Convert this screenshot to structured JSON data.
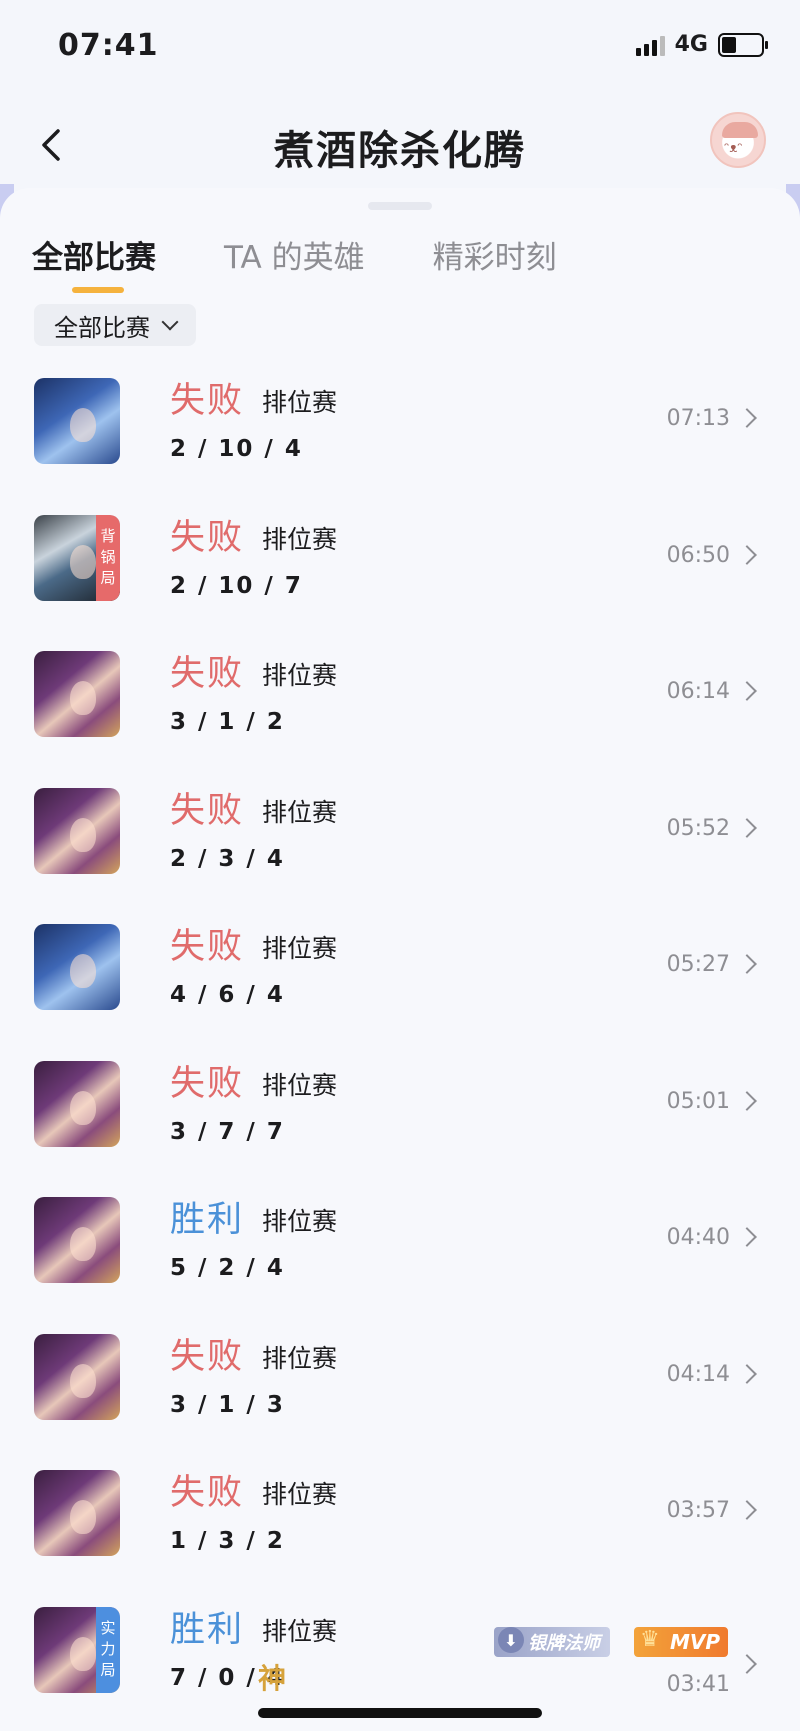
{
  "status_bar": {
    "time": "07:41",
    "network": "4G"
  },
  "header": {
    "title": "煮酒除杀化腾"
  },
  "tabs": [
    {
      "label": "全部比赛",
      "active": true
    },
    {
      "label": "TA 的英雄",
      "active": false
    },
    {
      "label": "精彩时刻",
      "active": false
    }
  ],
  "filter": {
    "label": "全部比赛"
  },
  "matches": [
    {
      "result": "失败",
      "mode": "排位赛",
      "kda": "2 / 10 / 4",
      "time": "07:13",
      "hero": "blue"
    },
    {
      "result": "失败",
      "mode": "排位赛",
      "kda": "2 / 10 / 7",
      "time": "06:50",
      "hero": "dark",
      "badge": [
        "背",
        "锅",
        "局"
      ]
    },
    {
      "result": "失败",
      "mode": "排位赛",
      "kda": "3 / 1 / 2",
      "time": "06:14",
      "hero": "purple"
    },
    {
      "result": "失败",
      "mode": "排位赛",
      "kda": "2 / 3 / 4",
      "time": "05:52",
      "hero": "purple"
    },
    {
      "result": "失败",
      "mode": "排位赛",
      "kda": "4 / 6 / 4",
      "time": "05:27",
      "hero": "blue"
    },
    {
      "result": "失败",
      "mode": "排位赛",
      "kda": "3 / 7 / 7",
      "time": "05:01",
      "hero": "purple"
    },
    {
      "result": "胜利",
      "mode": "排位赛",
      "kda": "5 / 2 / 4",
      "time": "04:40",
      "hero": "purple"
    },
    {
      "result": "失败",
      "mode": "排位赛",
      "kda": "3 / 1 / 3",
      "time": "04:14",
      "hero": "purple"
    },
    {
      "result": "失败",
      "mode": "排位赛",
      "kda": "1 / 3 / 2",
      "time": "03:57",
      "hero": "purple"
    },
    {
      "result": "胜利",
      "mode": "排位赛",
      "kda": "7 / 0 / 4",
      "time": "03:41",
      "hero": "purple",
      "badge": [
        "实",
        "力",
        "局"
      ],
      "god_mark": "神",
      "tags": {
        "silver": "银牌法师",
        "mvp": "MVP"
      }
    }
  ],
  "colors": {
    "lose": "#e06b6b",
    "win": "#4b91d8",
    "tab_underline": "#f5b23d"
  }
}
